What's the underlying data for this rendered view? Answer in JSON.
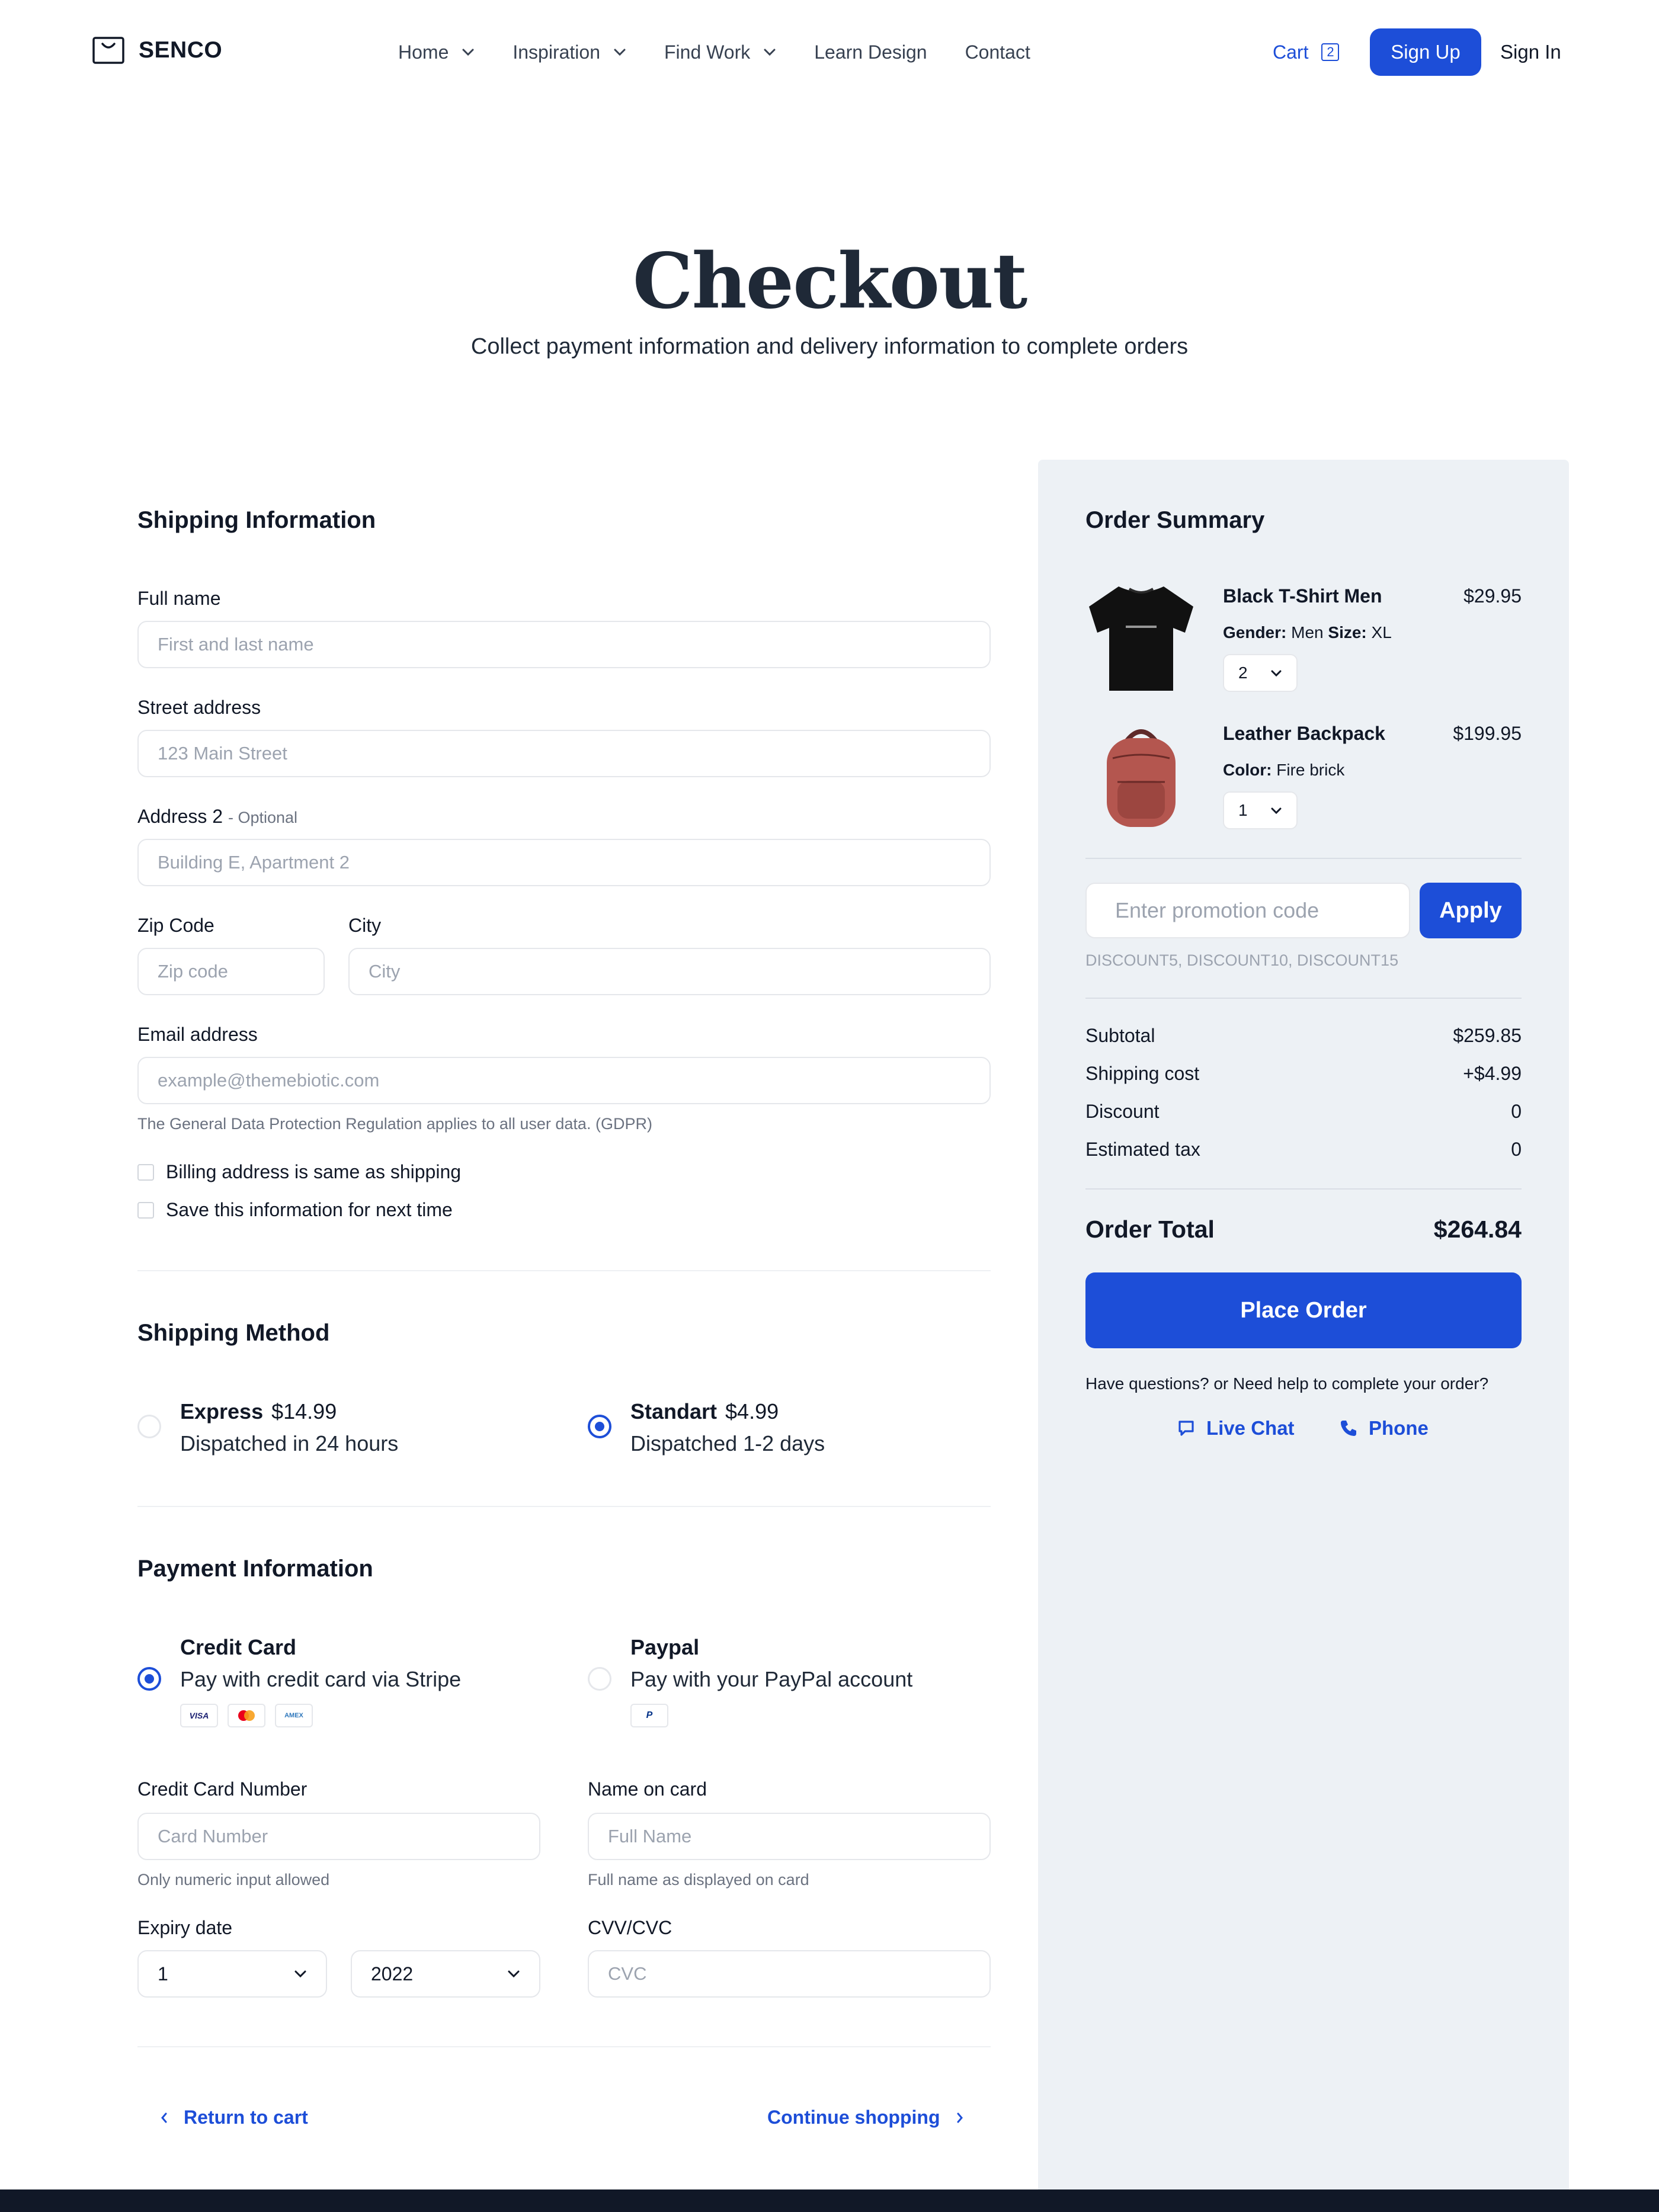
{
  "brand": {
    "name": "SENCO"
  },
  "nav": {
    "items": [
      {
        "label": "Home",
        "has_dropdown": true
      },
      {
        "label": "Inspiration",
        "has_dropdown": true
      },
      {
        "label": "Find Work",
        "has_dropdown": true
      },
      {
        "label": "Learn Design",
        "has_dropdown": false
      },
      {
        "label": "Contact",
        "has_dropdown": false
      }
    ],
    "cart_label": "Cart",
    "cart_count": "2",
    "signup_label": "Sign Up",
    "signin_label": "Sign In"
  },
  "hero": {
    "title": "Checkout",
    "subtitle": "Collect payment information and delivery information to complete orders"
  },
  "shipping_info": {
    "title": "Shipping Information",
    "full_name": {
      "label": "Full name",
      "placeholder": "First and last name"
    },
    "street": {
      "label": "Street address",
      "placeholder": "123 Main Street"
    },
    "address2": {
      "label": "Address 2",
      "optional": "- Optional",
      "placeholder": "Building E, Apartment 2"
    },
    "zip": {
      "label": "Zip Code",
      "placeholder": "Zip code"
    },
    "city": {
      "label": "City",
      "placeholder": "City"
    },
    "email": {
      "label": "Email address",
      "placeholder": "example@themebiotic.com",
      "hint": "The General Data Protection Regulation applies to all user data. (GDPR)"
    },
    "billing_same": {
      "label": "Billing address is same as shipping",
      "checked": false
    },
    "save_info": {
      "label": "Save this information for next time",
      "checked": false
    }
  },
  "shipping_method": {
    "title": "Shipping Method",
    "options": [
      {
        "name": "Express",
        "price": "$14.99",
        "desc": "Dispatched in 24 hours",
        "selected": false
      },
      {
        "name": "Standart",
        "price": "$4.99",
        "desc": "Dispatched 1-2 days",
        "selected": true
      }
    ]
  },
  "payment": {
    "title": "Payment Information",
    "options": [
      {
        "name": "Credit Card",
        "desc": "Pay with credit card via Stripe",
        "selected": true,
        "logos": [
          "VISA",
          "mastercard",
          "AMEX"
        ]
      },
      {
        "name": "Paypal",
        "desc": "Pay with your PayPal account",
        "selected": false,
        "logos": [
          "P"
        ]
      }
    ],
    "card_number": {
      "label": "Credit Card Number",
      "placeholder": "Card Number",
      "hint": "Only numeric input allowed"
    },
    "name_on_card": {
      "label": "Name on card",
      "placeholder": "Full Name",
      "hint": "Full name as displayed on card"
    },
    "expiry": {
      "label": "Expiry date",
      "month": "1",
      "year": "2022"
    },
    "cvv": {
      "label": "CVV/CVC",
      "placeholder": "CVC"
    }
  },
  "footer_links": {
    "return": "Return to cart",
    "continue": "Continue shopping"
  },
  "summary": {
    "title": "Order Summary",
    "items": [
      {
        "name": "Black T-Shirt Men",
        "price": "$29.95",
        "meta1_key": "Gender:",
        "meta1_val": "Men",
        "meta2_key": "Size:",
        "meta2_val": "XL",
        "qty": "2"
      },
      {
        "name": "Leather Backpack",
        "price": "$199.95",
        "meta1_key": "Color:",
        "meta1_val": "Fire brick",
        "qty": "1"
      }
    ],
    "promo_placeholder": "Enter promotion code",
    "apply_label": "Apply",
    "promo_hint": "DISCOUNT5, DISCOUNT10, DISCOUNT15",
    "rows": [
      {
        "label": "Subtotal",
        "value": "$259.85"
      },
      {
        "label": "Shipping cost",
        "value": "+$4.99"
      },
      {
        "label": "Discount",
        "value": "0"
      },
      {
        "label": "Estimated tax",
        "value": "0"
      }
    ],
    "total_label": "Order Total",
    "total_value": "$264.84",
    "place_order_label": "Place Order",
    "help_text": "Have questions? or Need help to complete your order?",
    "live_chat_label": "Live Chat",
    "phone_label": "Phone"
  },
  "colors": {
    "accent": "#1d4ed8",
    "summary_bg": "#edf1f5",
    "footer_bg": "#111827"
  }
}
